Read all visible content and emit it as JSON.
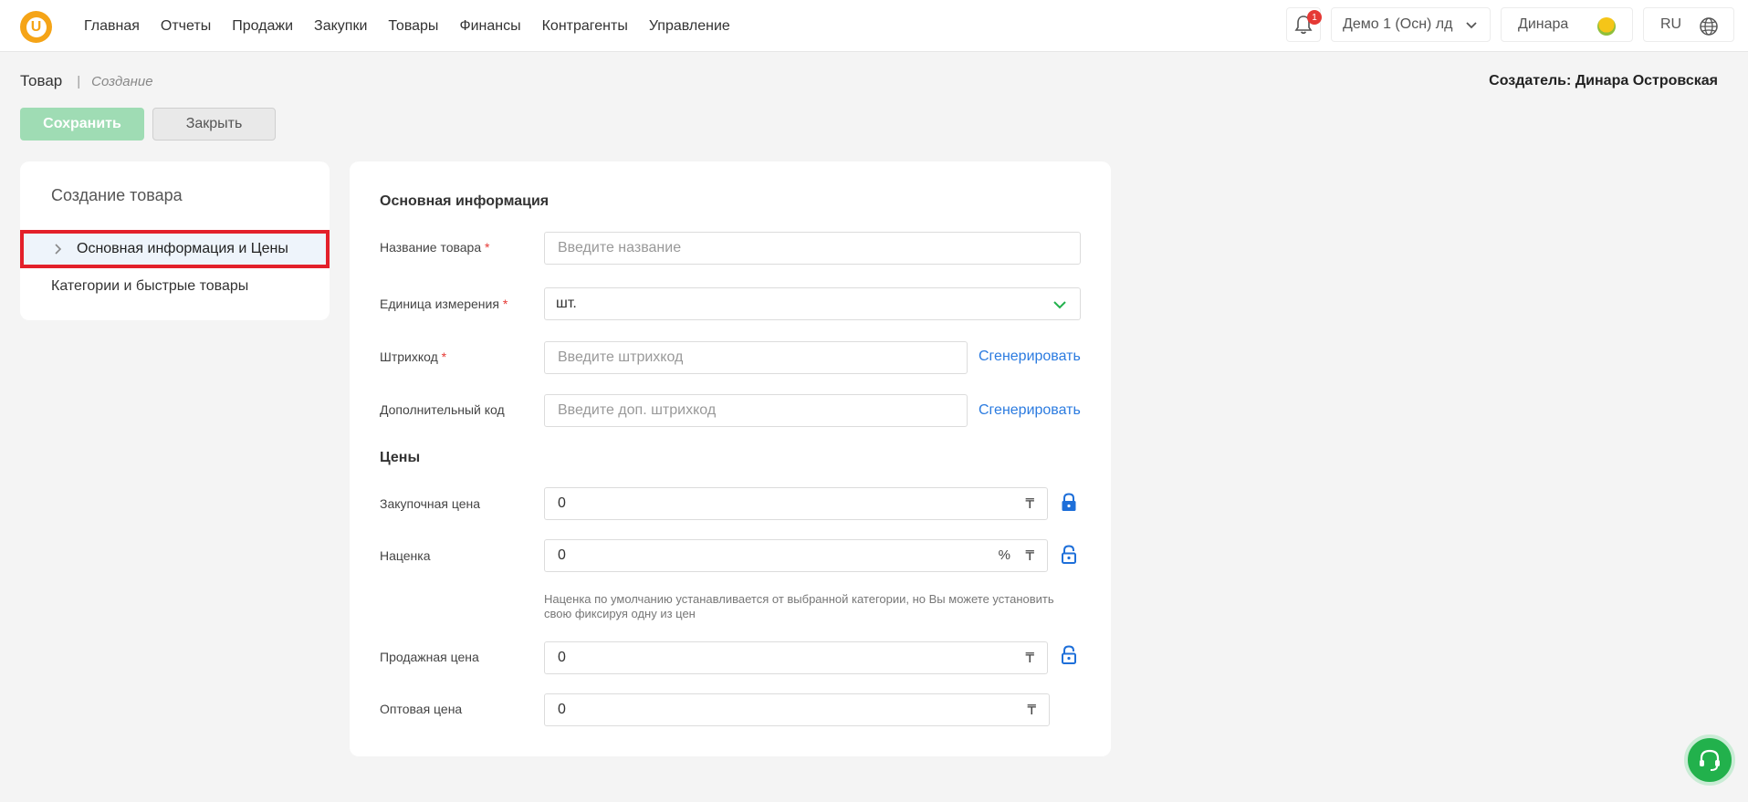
{
  "brand": {
    "logo_letter": "U",
    "accent": "#f5a417"
  },
  "nav": {
    "items": [
      "Главная",
      "Отчеты",
      "Продажи",
      "Закупки",
      "Товары",
      "Финансы",
      "Контрагенты",
      "Управление"
    ]
  },
  "header": {
    "notifications_count": "1",
    "org_name": "Демо 1 (Осн) лд",
    "user_name": "Динара",
    "lang": "RU"
  },
  "page": {
    "title": "Товар",
    "subtitle": "Создание",
    "creator_label": "Создатель: Динара Островская"
  },
  "toolbar": {
    "save_label": "Сохранить",
    "close_label": "Закрыть"
  },
  "sidebar": {
    "title": "Создание товара",
    "items": [
      {
        "label": "Основная информация и Цены",
        "active": true
      },
      {
        "label": "Категории и быстрые товары",
        "active": false
      }
    ]
  },
  "form": {
    "section_main": "Основная информация",
    "name": {
      "label": "Название товара",
      "placeholder": "Введите название",
      "required": true
    },
    "unit": {
      "label": "Единица измерения",
      "value": "шт.",
      "required": true
    },
    "barcode": {
      "label": "Штрихкод",
      "placeholder": "Введите штрихкод",
      "required": true,
      "generate": "Сгенерировать"
    },
    "extra_code": {
      "label": "Дополнительный код",
      "placeholder": "Введите доп. штрихкод",
      "generate": "Сгенерировать"
    },
    "section_prices": "Цены",
    "purchase_price": {
      "label": "Закупочная цена",
      "value": "0",
      "currency": "₸"
    },
    "markup": {
      "label": "Наценка",
      "value": "0",
      "percent": "%",
      "currency": "₸"
    },
    "markup_hint": "Наценка по умолчанию устанавливается от выбранной категории, но Вы можете установить свою фиксируя одну из цен",
    "sale_price": {
      "label": "Продажная цена",
      "value": "0",
      "currency": "₸"
    },
    "wholesale_price": {
      "label": "Оптовая цена",
      "value": "0",
      "currency": "₸"
    }
  },
  "required_mark": "*"
}
